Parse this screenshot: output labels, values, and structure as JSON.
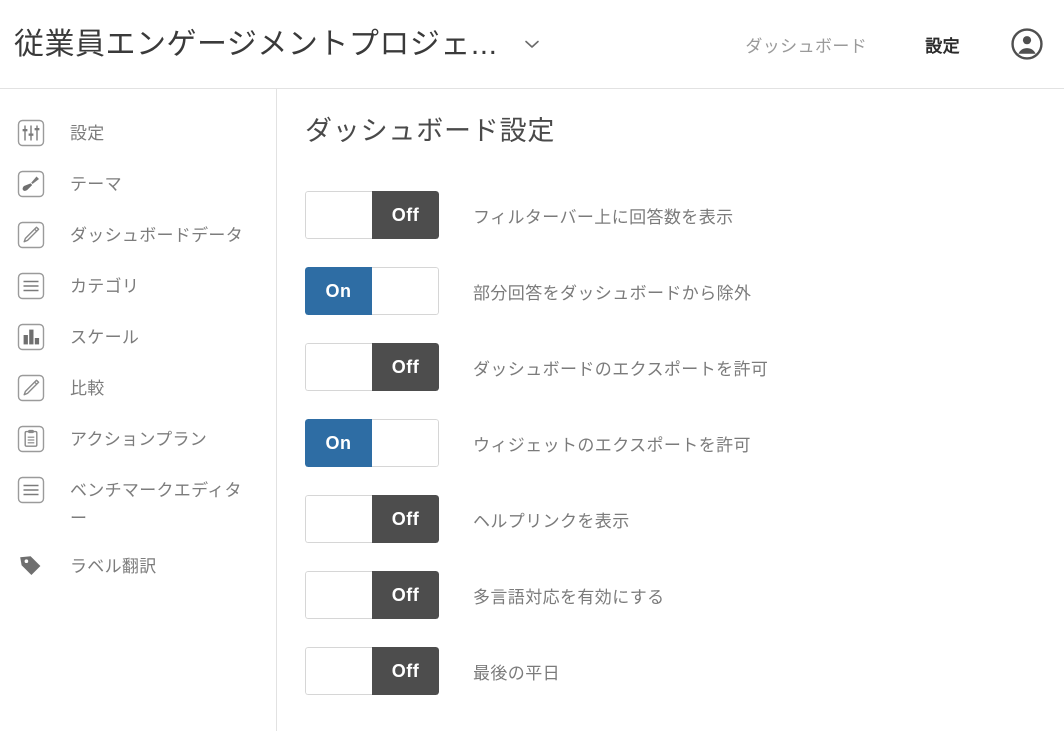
{
  "header": {
    "app_title": "従業員エンゲージメントプロジェ...",
    "dropdown_icon": "chevron-down-icon",
    "nav": [
      {
        "label": "ダッシュボード",
        "state": "inactive"
      },
      {
        "label": "設定",
        "state": "active"
      }
    ],
    "avatar_icon": "account-circle-icon"
  },
  "sidebar": {
    "items": [
      {
        "label": "設定",
        "icon": "sliders-icon"
      },
      {
        "label": "テーマ",
        "icon": "brush-icon"
      },
      {
        "label": "ダッシュボードデータ",
        "icon": "pencil-icon"
      },
      {
        "label": "カテゴリ",
        "icon": "list-icon"
      },
      {
        "label": "スケール",
        "icon": "bar-chart-icon"
      },
      {
        "label": "比較",
        "icon": "pencil-icon"
      },
      {
        "label": "アクションプラン",
        "icon": "clipboard-icon"
      },
      {
        "label": "ベンチマークエディター",
        "icon": "list-icon"
      },
      {
        "label": "ラベル翻訳",
        "icon": "tag-icon"
      }
    ]
  },
  "main": {
    "page_title": "ダッシュボード設定",
    "toggle_labels": {
      "on": "On",
      "off": "Off"
    },
    "settings": [
      {
        "state": "Off",
        "label": "フィルターバー上に回答数を表示"
      },
      {
        "state": "On",
        "label": "部分回答をダッシュボードから除外"
      },
      {
        "state": "Off",
        "label": "ダッシュボードのエクスポートを許可"
      },
      {
        "state": "On",
        "label": "ウィジェットのエクスポートを許可"
      },
      {
        "state": "Off",
        "label": "ヘルプリンクを表示"
      },
      {
        "state": "Off",
        "label": "多言語対応を有効にする"
      },
      {
        "state": "Off",
        "label": "最後の平日"
      }
    ]
  },
  "colors": {
    "toggle_on_blue": "#2e6da4",
    "toggle_off_gray": "#4d4d4d",
    "text_gray": "#7b7b7b",
    "title_dark": "#3a3a3a",
    "border": "#e2e2e2"
  }
}
